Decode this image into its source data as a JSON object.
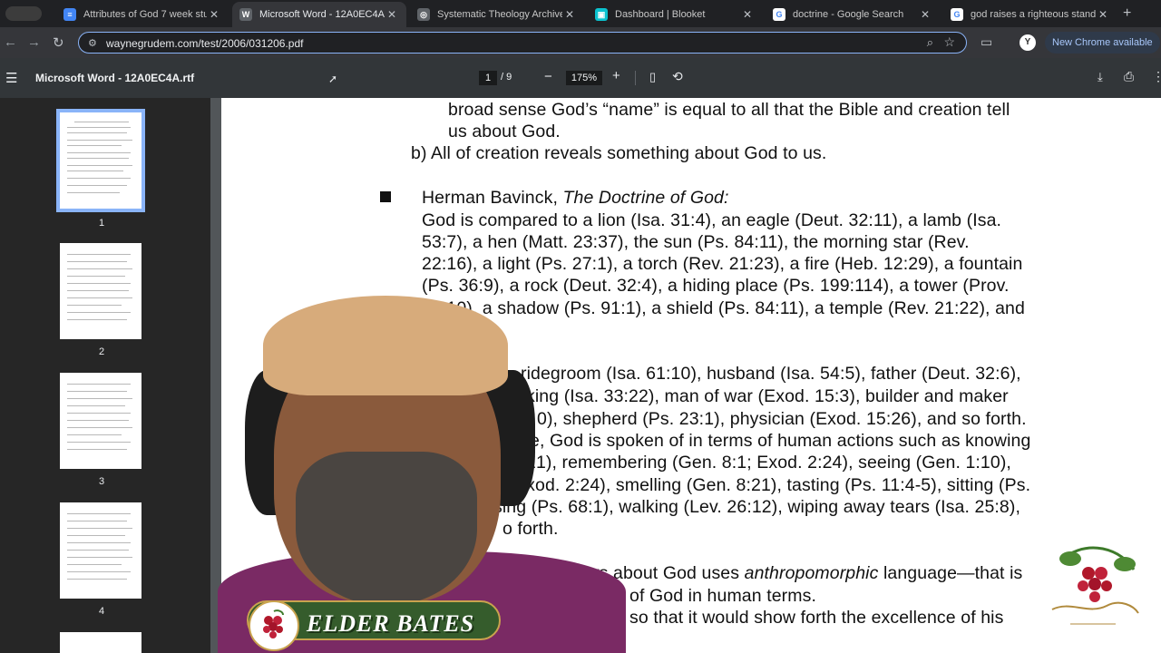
{
  "tabs": [
    {
      "title": "Attributes of God 7 week stu",
      "icon": "docs-icon",
      "color": "#4285f4",
      "glyph": "≡",
      "active": false
    },
    {
      "title": "Microsoft Word - 12A0EC4A.",
      "icon": "wordpress-icon",
      "color": "#5f6368",
      "glyph": "W",
      "active": true
    },
    {
      "title": "Systematic Theology Archive",
      "icon": "site-icon",
      "color": "#5f6368",
      "glyph": "◎",
      "active": false
    },
    {
      "title": "Dashboard | Blooket",
      "icon": "blooket-icon",
      "color": "#0bc2cf",
      "glyph": "▣",
      "active": false
    },
    {
      "title": "doctrine - Google Search",
      "icon": "google-icon",
      "color": "#ffffff",
      "glyph": "G",
      "active": false
    },
    {
      "title": "god raises a righteous stand",
      "icon": "google-icon",
      "color": "#ffffff",
      "glyph": "G",
      "active": false
    }
  ],
  "address": {
    "url": "waynegrudem.com/test/2006/031206.pdf"
  },
  "chrome": {
    "new_chrome": "New Chrome available"
  },
  "pdf": {
    "title": "Microsoft Word - 12A0EC4A.rtf",
    "current_page": "1",
    "total_pages": "/ 9",
    "zoom": "175%"
  },
  "thumbnails": [
    "1",
    "2",
    "3",
    "4"
  ],
  "page_text": {
    "l1": "broad sense God’s “name” is equal to all that the Bible and creation tell",
    "l2": "us about God.",
    "l3": "b) All of creation reveals something about God to us.",
    "l4a": "Herman Bavinck, ",
    "l4b": "The Doctrine of God:",
    "l5": "God is compared to a lion (Isa. 31:4), an eagle (Deut. 32:11), a lamb (Isa.",
    "l6": "53:7), a hen (Matt. 23:37), the sun (Ps. 84:11), the morning star (Rev.",
    "l7": "22:16), a light (Ps. 27:1), a torch (Rev. 21:23), a fire (Heb. 12:29), a fountain",
    "l8": "(Ps. 36:9), a rock (Deut. 32:4), a hiding place (Ps. 199:114), a tower (Prov.",
    "l9": "18:10), a shadow (Ps. 91:1), a shield (Ps. 84:11), a temple (Rev. 21:22), and",
    "l10": "ridegroom (Isa. 61:10), husband (Isa. 54:5), father (Deut. 32:6),",
    "l11": "king (Isa. 33:22), man of war (Exod. 15:3), builder and maker",
    "l12": "0), shepherd (Ps. 23:1), physician (Exod. 15:26), and so forth.",
    "l13": "e, God is spoken of in terms of human actions such as knowing",
    "l14": "21), remembering (Gen. 8:1; Exod. 2:24), seeing (Gen. 1:10),",
    "l15": "g (Exod. 2:24), smelling (Gen. 8:21), tasting (Ps. 11:4-5), sitting (Ps.",
    "l16": "sing (Ps. 68:1), walking (Lev. 26:12), wiping away tears (Isa. 25:8),",
    "l17": "o forth.",
    "l18a": "says about God uses ",
    "l18b": "anthropomorphic",
    "l18c": " language—that is",
    "l19": "of God in human terms.",
    "l20": "so that it would show forth the excellence of his"
  },
  "overlay": {
    "speaker_name": "ELDER BATES"
  }
}
